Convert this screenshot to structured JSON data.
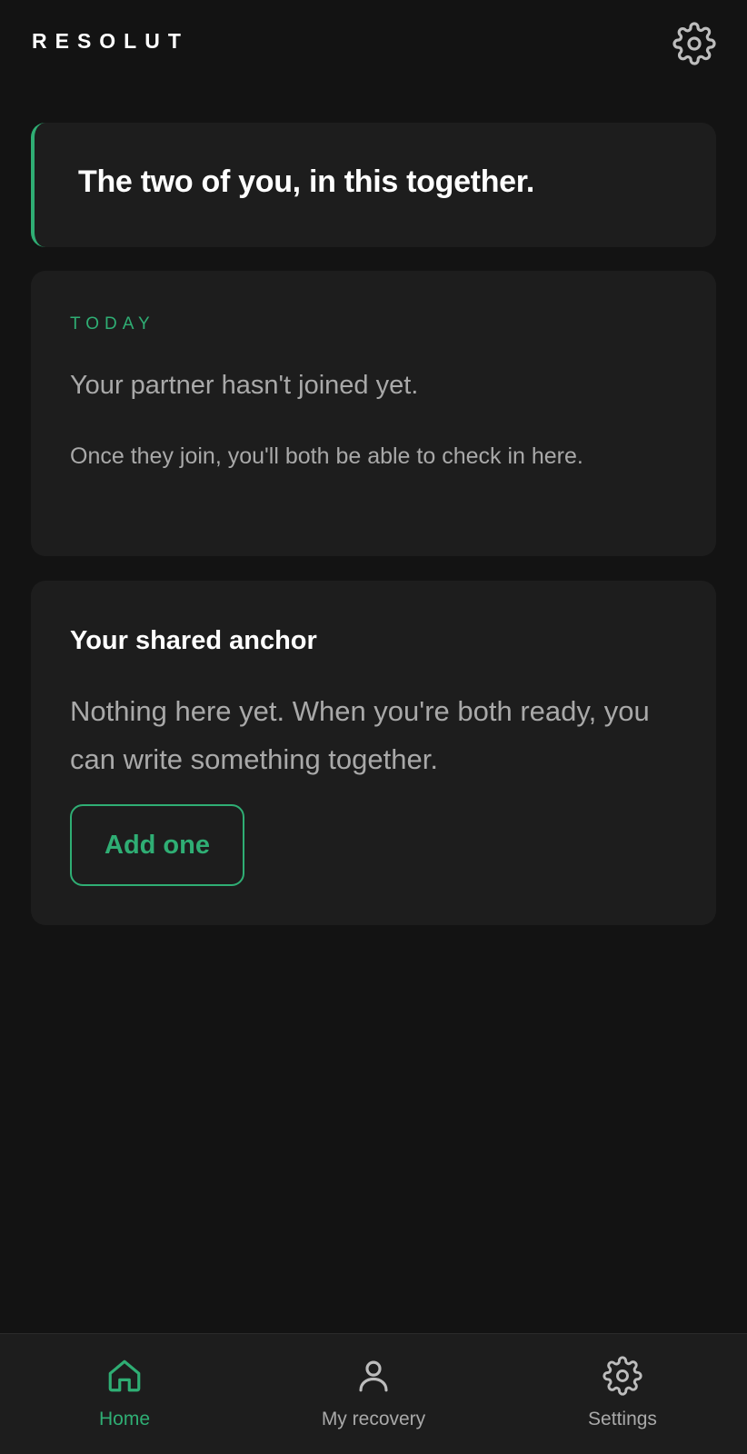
{
  "app": {
    "brand": "RESOLUT"
  },
  "hero": {
    "text": "The two of you, in this together."
  },
  "today": {
    "label": "TODAY",
    "primary": "Your partner hasn't joined yet.",
    "secondary": "Once they join, you'll both be able to check in here."
  },
  "anchor": {
    "title": "Your shared anchor",
    "body": "Nothing here yet. When you're both ready, you can write something together.",
    "button_label": "Add one"
  },
  "nav": {
    "items": [
      {
        "label": "Home",
        "icon": "home-icon",
        "active": true
      },
      {
        "label": "My recovery",
        "icon": "person-icon",
        "active": false
      },
      {
        "label": "Settings",
        "icon": "gear-icon",
        "active": false
      }
    ]
  },
  "colors": {
    "background": "#131313",
    "card": "#1d1d1d",
    "accent": "#2fae74",
    "muted_text": "#a9a9a9",
    "text": "#ffffff"
  }
}
